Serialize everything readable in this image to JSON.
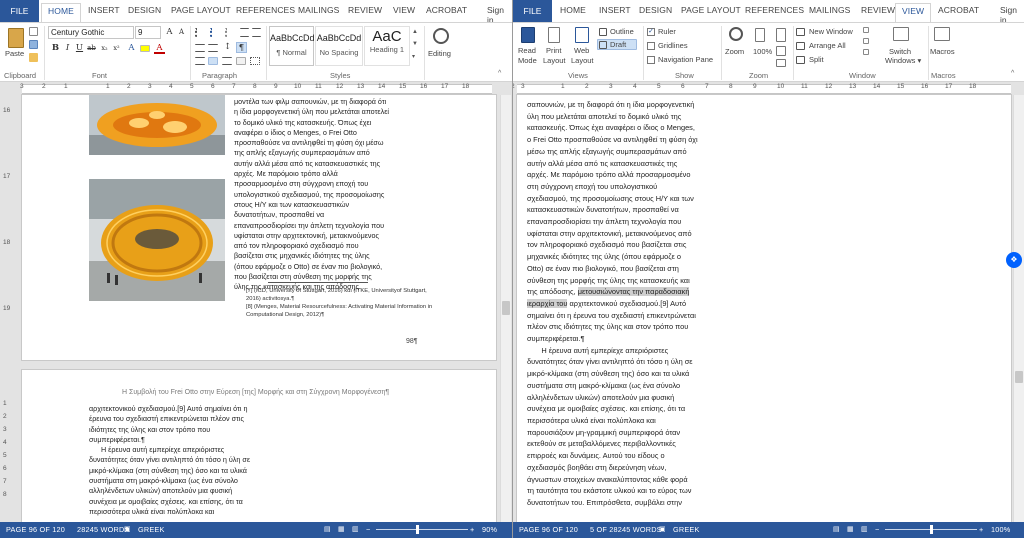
{
  "left_window": {
    "tabs": [
      "FILE",
      "HOME",
      "INSERT",
      "DESIGN",
      "PAGE LAYOUT",
      "REFERENCES",
      "MAILINGS",
      "REVIEW",
      "VIEW",
      "ACROBAT"
    ],
    "active_tab": "HOME",
    "sign_in": "Sign in",
    "clipboard": {
      "paste_label": "Paste",
      "group_label": "Clipboard"
    },
    "font": {
      "font_name": "Century Gothic",
      "font_size": "9",
      "group_label": "Font"
    },
    "paragraph": {
      "group_label": "Paragraph"
    },
    "styles": {
      "group_label": "Styles",
      "items": [
        {
          "sample": "AaBbCcDd",
          "name": "¶ Normal"
        },
        {
          "sample": "AaBbCcDd",
          "name": "No Spacing"
        },
        {
          "sample": "AaC",
          "name": "Heading 1"
        }
      ]
    },
    "editing": {
      "label": "Editing"
    },
    "ruler_numbers": [
      "3",
      "2",
      "1",
      "1",
      "2",
      "3",
      "4",
      "5",
      "6",
      "7",
      "8",
      "9",
      "10",
      "11",
      "12",
      "13",
      "14",
      "15",
      "16",
      "17",
      "18"
    ],
    "vruler_numbers": [
      "16",
      "17",
      "18",
      "19",
      "1",
      "2",
      "3",
      "4",
      "5",
      "6",
      "7",
      "8"
    ],
    "page1": {
      "body": "μοντέλα των φιλμ σαπουνιών, με τη διαφορά ότι\nη ίδια μορφογενετική ύλη που μελετάται αποτελεί\nτο δομικό υλικό της κατασκευής. Όπως έχει\nαναφέρει ο ίδιος ο Menges, ο Frei Otto\nπροσπαθούσε να αντιληφθεί τη φύση όχι μέσω\nτης απλής εξαγωγής συμπερασμάτων από\nαυτήν αλλά μέσα από τις κατασκευαστικές της\nαρχές. Με παρόμοιο τρόπο αλλά\nπροσαρμοσμένο στη σύγχρονη εποχή του\nυπολογιστικού σχεδιασμού, της προσομοίωσης\nστους Η/Υ και των κατασκευαστικών\nδυνατοτήτων, προσπαθεί να\nεπαναπροσδιορίσει την άπλετη τεχνολογία που\nυφίσταται στην αρχιτεκτονική, μετακινούμενος\nαπό τον πληροφοριακό σχεδιασμό που\nβασίζεται στις μηχανικές ιδιότητες της ύλης\n(όπου εφάρμοζε ο Otto) σε έναν πιο βιολογικό,\nπου βασίζεται στη σύνθεση της μορφής της\nύλης της κατασκευής και της απόδοσης.",
      "footnote_1": "[7] (ICD, University of Stuttgart, 2016) και (ITKE, Universityof Stuttgart, 2016) activitosya.¶",
      "footnote_2": "[8] (Menges, Material Resourcefulness: Activating Material Information in Computational Design, 2012)¶",
      "page_number": "98¶"
    },
    "page2": {
      "header": "Η Συμβολή του Frei Otto στην Εύρεση [της] Μορφής και στη Σύγχρονη Μορφογένεση¶",
      "body": "αρχιτεκτονικού σχεδιασμού.[9] Αυτό σημαίνει ότι η\nέρευνα του σχεδιαστή επικεντρώνεται πλέον στις\nιδιότητες της ύλης και στον τρόπο που\nσυμπεριφέρεται.¶\n      Η έρευνα αυτή εμπερίεχε απεριόριστες\nδυνατότητες όταν γίνει αντιληπτό ότι τόσο η ύλη σε\nμικρό-κλίμακα (στη σύνθεση της) όσο και τα υλικά\nσυστήματα στη μακρό-κλίμακα (ως ένα σύνολο\nαλληλένδετων υλικών) αποτελούν μια φυσική\nσυνέχεια με ομοιβαίες σχέσεις. και επίσης, ότι τα\nπερισσότερα υλικά είναι πολύπλοκα και"
    },
    "status": {
      "page": "PAGE 96 OF 120",
      "words": "28245 WORDS",
      "language": "GREEK",
      "zoom": "90%"
    }
  },
  "right_window": {
    "tabs": [
      "FILE",
      "HOME",
      "INSERT",
      "DESIGN",
      "PAGE LAYOUT",
      "REFERENCES",
      "MAILINGS",
      "REVIEW",
      "VIEW",
      "ACROBAT"
    ],
    "active_tab": "VIEW",
    "sign_in": "Sign in",
    "views": {
      "group_label": "Views",
      "read_mode": [
        "Read",
        "Mode"
      ],
      "print_layout": [
        "Print",
        "Layout"
      ],
      "web_layout": [
        "Web",
        "Layout"
      ],
      "outline": "Outline",
      "draft": "Draft"
    },
    "show": {
      "group_label": "Show",
      "ruler": "Ruler",
      "gridlines": "Gridlines",
      "navigation_pane": "Navigation Pane",
      "ruler_checked": true
    },
    "zoom": {
      "group_label": "Zoom",
      "zoom": "Zoom",
      "hundred": "100%"
    },
    "window": {
      "group_label": "Window",
      "new_window": "New Window",
      "arrange_all": "Arrange All",
      "split": "Split",
      "switch_windows": [
        "Switch",
        "Windows ▾"
      ]
    },
    "macros": {
      "group_label": "Macros",
      "label": "Macros"
    },
    "ruler_numbers": [
      "3",
      "2",
      "1",
      "1",
      "2",
      "3",
      "4",
      "5",
      "6",
      "7",
      "8",
      "9",
      "10",
      "11",
      "12",
      "13",
      "14",
      "15",
      "16",
      "17",
      "18"
    ],
    "body_before": "σαπουνιών, με τη διαφορά ότι η ίδια μορφογενετική\nύλη που μελετάται αποτελεί το δομικό υλικό της\nκατασκευής. Όπως έχει αναφέρει ο ίδιος ο Menges,\nο Frei Otto προσπαθούσε να αντιληφθεί τη φύση όχι\nμέσω της απλής εξαγωγής συμπερασμάτων από\nαυτήν αλλά μέσα από τις κατασκευαστικές της\nαρχές. Με παρόμοιο τρόπο αλλά προσαρμοσμένο\nστη σύγχρονη εποχή του υπολογιστικού\nσχεδιασμού, της προσομοίωσης στους Η/Υ και των\nκατασκευαστικών δυνατοτήτων, προσπαθεί να\nεπαναπροσδιορίσει την άπλετη τεχνολογία που\nυφίσταται στην αρχιτεκτονική, μετακινούμενος από\nτον πληροφοριακό σχεδιασμό που βασίζεται στις\nμηχανικές ιδιότητες της ύλης (όπου εφάρμοζε ο\nOtto) σε έναν πιο βιολογικό, που βασίζεται στη\nσύνθεση της μορφής της ύλης της κατασκευής και\nτης απόδοσης, ",
    "body_highlight_1": "μετουσιώνοντας την παραδοσιακή",
    "body_highlight_2": "ιεραρχία του",
    "body_after": " αρχιτεκτονικού σχεδιασμού.[9] Αυτό\nσημαίνει ότι η έρευνα του σχεδιαστή επικεντρώνεται\nπλέον στις ιδιότητες της ύλης και στον τρόπο που\nσυμπεριφέρεται.¶\n       Η έρευνα αυτή εμπερίεχε απεριόριστες\nδυνατότητες όταν γίνει αντιληπτό ότι τόσο η ύλη σε\nμικρό-κλίμακα (στη σύνθεση της) όσο και τα υλικά\nσυστήματα στη μακρό-κλίμακα (ως ένα σύνολο\nαλληλένδετων υλικών) αποτελούν μια φυσική\nσυνέχεια με ομοιβαίες σχέσεις. και επίσης, ότι τα\nπερισσότερα υλικά είναι πολύπλοκα και\nπαρουσιάζουν μη-γραμμική συμπεριφορά όταν\nεκτεθούν σε μεταβαλλόμενες περιβαλλοντικές\nεπιρροές και δυνάμεις. Αυτού του είδους ο\nσχεδιασμός βοηθάει στη διερεύνηση νέων,\nάγνωστων στοιχείων ανακαλύπτοντας κάθε φορά\nτη ταυτότητα του εκάστοτε υλικού και το εύρος των\nδυνατοτήτων του. Επιπρόσθετα, συμβάλει στην",
    "status": {
      "page": "PAGE 96 OF 120",
      "words": "5 OF 28245 WORDS",
      "language": "GREEK",
      "zoom": "100%"
    }
  },
  "colors": {
    "accent": "#2b579a",
    "status_bar": "#2b579a",
    "highlight": "#cfcfcf",
    "pavilion_orange": "#f0a020"
  }
}
